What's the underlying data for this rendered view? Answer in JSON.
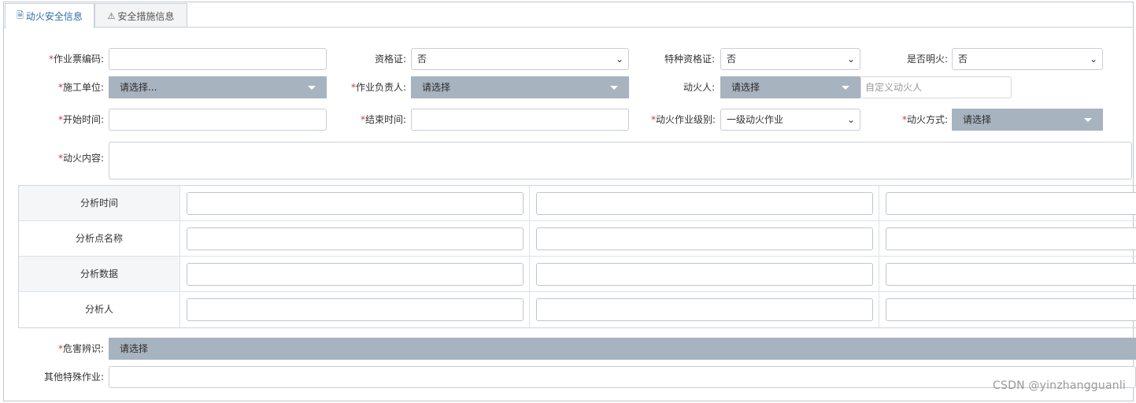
{
  "tabs": [
    {
      "label": "动火安全信息",
      "icon": "document-icon"
    },
    {
      "label": "安全措施信息",
      "icon": "warning-icon"
    }
  ],
  "form": {
    "ticket_code": {
      "label": "作业票编码:",
      "required": true,
      "value": ""
    },
    "qualification": {
      "label": "资格证:",
      "value": "否"
    },
    "special_qualification": {
      "label": "特种资格证:",
      "value": "否"
    },
    "open_fire": {
      "label": "是否明火:",
      "value": "否"
    },
    "construction_unit": {
      "label": "施工单位:",
      "required": true,
      "value": "请选择..."
    },
    "work_leader": {
      "label": "作业负责人:",
      "required": true,
      "value": "请选择"
    },
    "fire_person": {
      "label": "动火人:",
      "value": "请选择",
      "custom_placeholder": "自定义动火人"
    },
    "start_time": {
      "label": "开始时间:",
      "required": true,
      "value": ""
    },
    "end_time": {
      "label": "结束时间:",
      "required": true,
      "value": ""
    },
    "fire_level": {
      "label": "动火作业级别:",
      "required": true,
      "value": "一级动火作业"
    },
    "fire_method": {
      "label": "动火方式:",
      "required": true,
      "value": "请选择"
    },
    "fire_content": {
      "label": "动火内容:",
      "required": true,
      "value": ""
    }
  },
  "analysis": {
    "rows": [
      {
        "label": "分析时间"
      },
      {
        "label": "分析点名称"
      },
      {
        "label": "分析数据"
      },
      {
        "label": "分析人"
      }
    ]
  },
  "hazard": {
    "label": "危害辨识:",
    "required": true,
    "value": "请选择"
  },
  "other_special": {
    "label": "其他特殊作业:",
    "value": ""
  },
  "required_mark": "*",
  "watermark": "CSDN @yinzhangguanli",
  "colors": {
    "accent": "#2e6da4",
    "required": "#d9333f",
    "select_gray": "#a7b3bf"
  }
}
